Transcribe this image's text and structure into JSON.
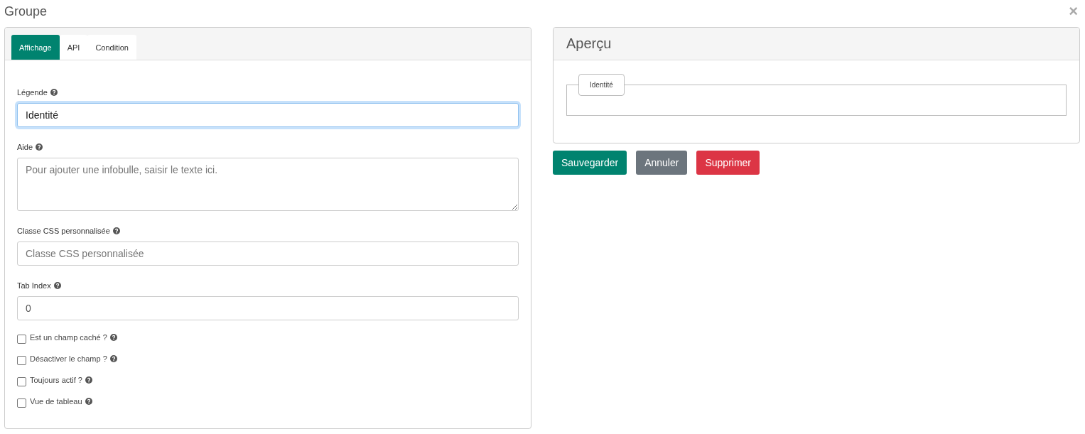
{
  "dialog": {
    "title": "Groupe",
    "close": "×"
  },
  "editor": {
    "tabs": [
      {
        "label": "Affichage",
        "selected": true
      },
      {
        "label": "API",
        "selected": false
      },
      {
        "label": "Condition",
        "selected": false
      }
    ],
    "fields": [
      {
        "kind": "input",
        "label": "Légende",
        "value": "Identité",
        "focused": true
      },
      {
        "kind": "textarea",
        "label": "Aide",
        "placeholder": "Pour ajouter une infobulle, saisir le texte ici.",
        "focused": false
      },
      {
        "kind": "input",
        "label": "Classe CSS personnalisée",
        "placeholder": "Classe CSS personnalisée",
        "focused": false
      },
      {
        "kind": "input",
        "label": "Tab Index",
        "value": "0",
        "focused": false
      }
    ],
    "checkboxes": [
      {
        "label": "Est un champ caché ?",
        "checked": false
      },
      {
        "label": "Désactiver le champ ?",
        "checked": false
      },
      {
        "label": "Toujours actif ?",
        "checked": false
      },
      {
        "label": "Vue de tableau",
        "checked": false
      }
    ]
  },
  "preview": {
    "title": "Aperçu",
    "group_legend": "Identité"
  },
  "buttons": [
    {
      "label": "Sauvegarder",
      "kind": "primary"
    },
    {
      "label": "Annuler",
      "kind": "secondary"
    },
    {
      "label": "Supprimer",
      "kind": "danger"
    }
  ]
}
